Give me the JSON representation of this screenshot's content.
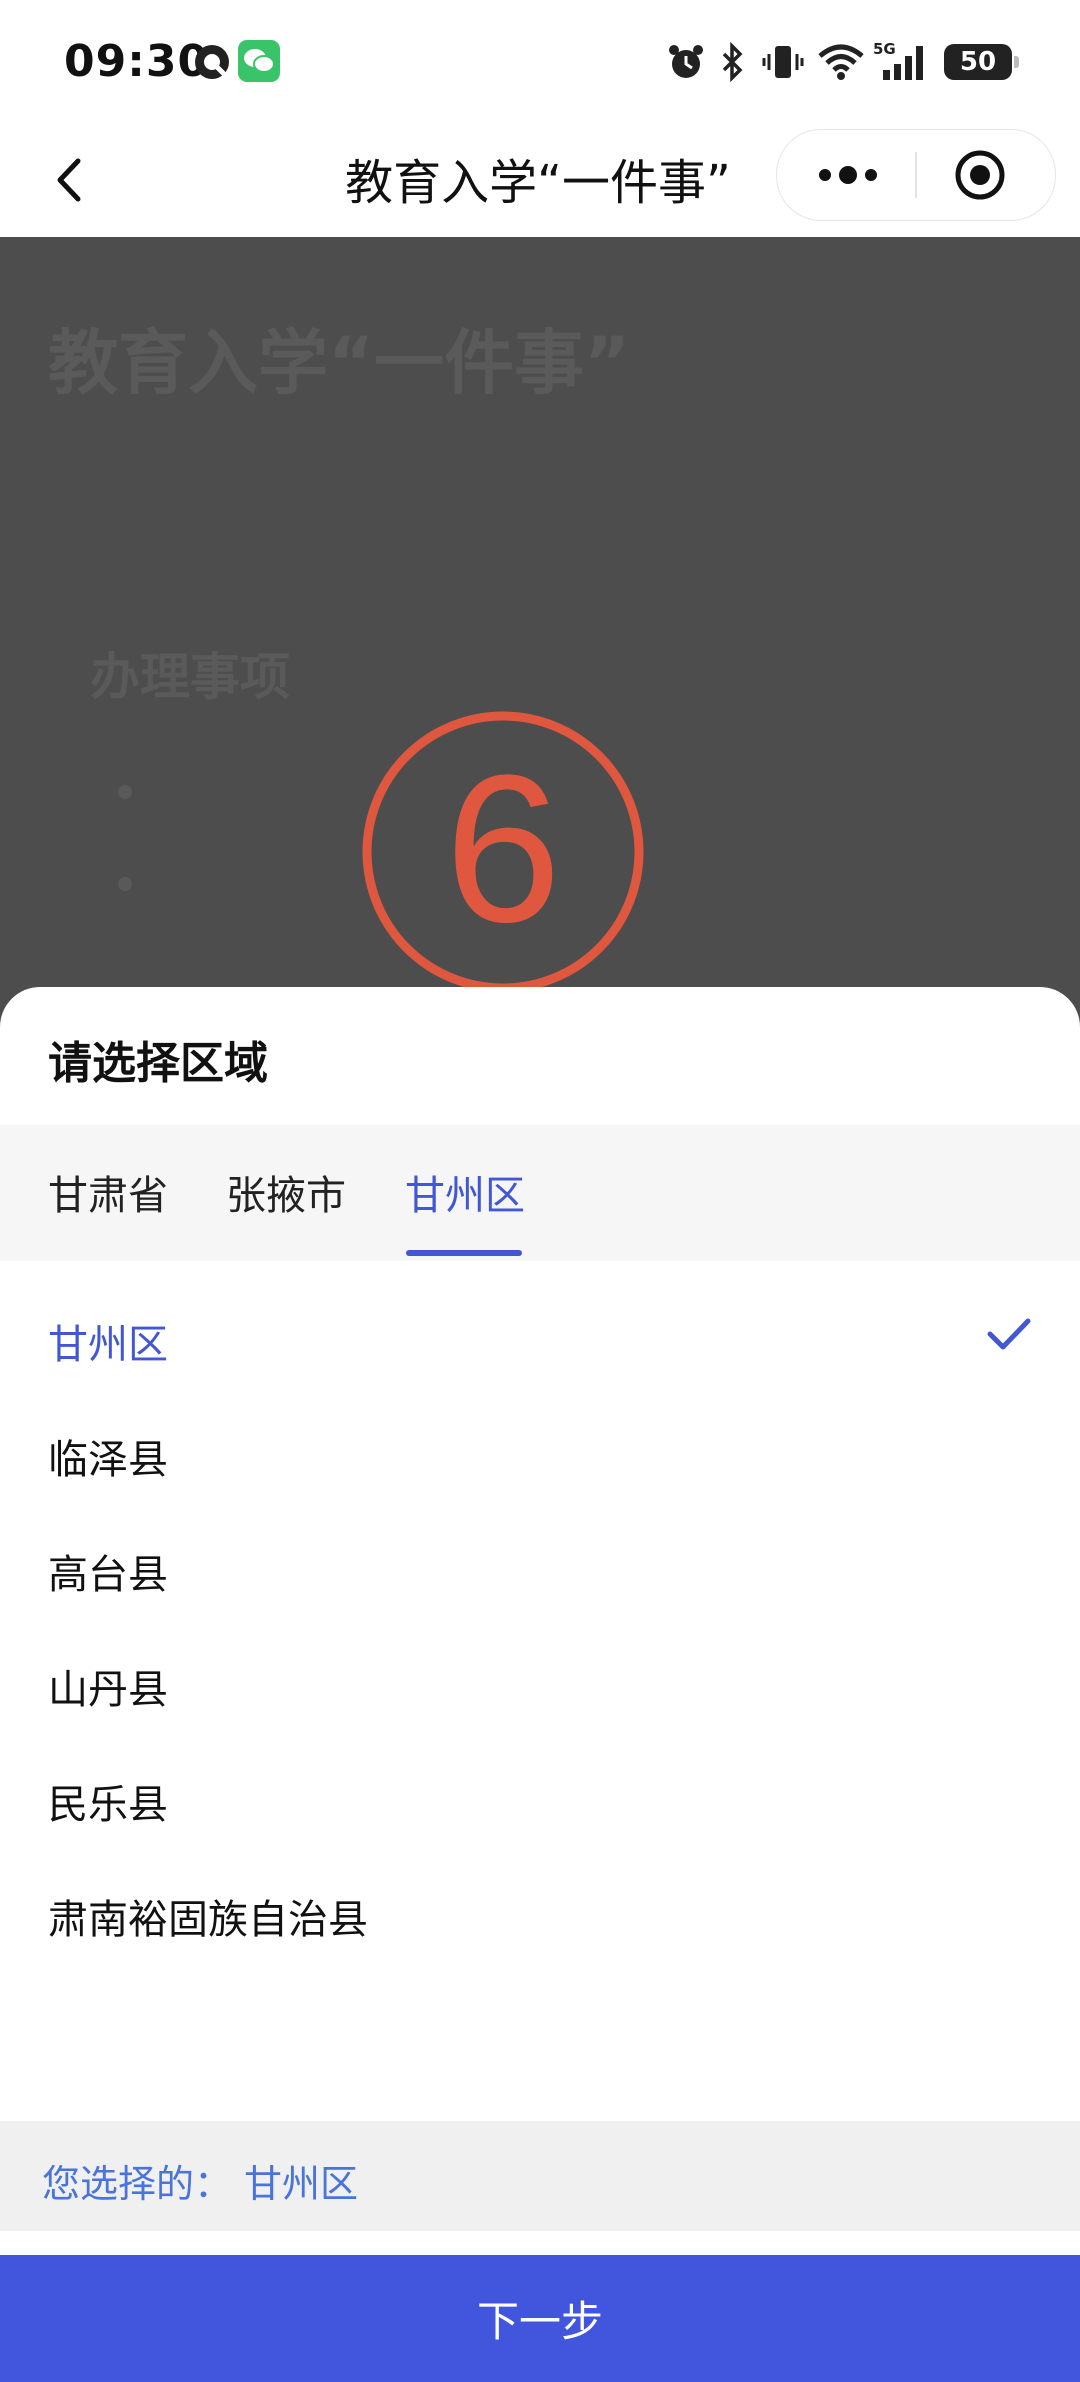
{
  "status_bar": {
    "time": "09:30",
    "battery": "50",
    "icons": [
      "navigation-icon",
      "wechat-icon",
      "alarm-icon",
      "bluetooth-icon",
      "vibrate-icon",
      "wifi-icon",
      "signal-5g-icon",
      "battery-icon"
    ]
  },
  "nav": {
    "title": "教育入学“一件事”",
    "back_icon": "chevron-left-icon",
    "more_icon": "more-dots-icon",
    "close_icon": "target-circle-icon"
  },
  "background_page": {
    "title": "教育入学“一件事”",
    "section": "办理事项"
  },
  "watermark": {
    "symbol": "6",
    "color": "#e0573f"
  },
  "sheet": {
    "title": "请选择区域",
    "tabs": [
      {
        "label": "甘肃省",
        "active": false
      },
      {
        "label": "张掖市",
        "active": false
      },
      {
        "label": "甘州区",
        "active": true
      }
    ],
    "options": [
      {
        "label": "甘州区",
        "selected": true
      },
      {
        "label": "临泽县",
        "selected": false
      },
      {
        "label": "高台县",
        "selected": false
      },
      {
        "label": "山丹县",
        "selected": false
      },
      {
        "label": "民乐县",
        "selected": false
      },
      {
        "label": "肃南裕固族自治县",
        "selected": false
      }
    ],
    "selected_prefix": "您选择的：",
    "selected_value": "甘州区",
    "next_button": "下一步"
  },
  "colors": {
    "accent": "#4257d6",
    "button": "#4156dc",
    "selected_text": "#4a74d9",
    "overlay": "#4d4d4d"
  }
}
